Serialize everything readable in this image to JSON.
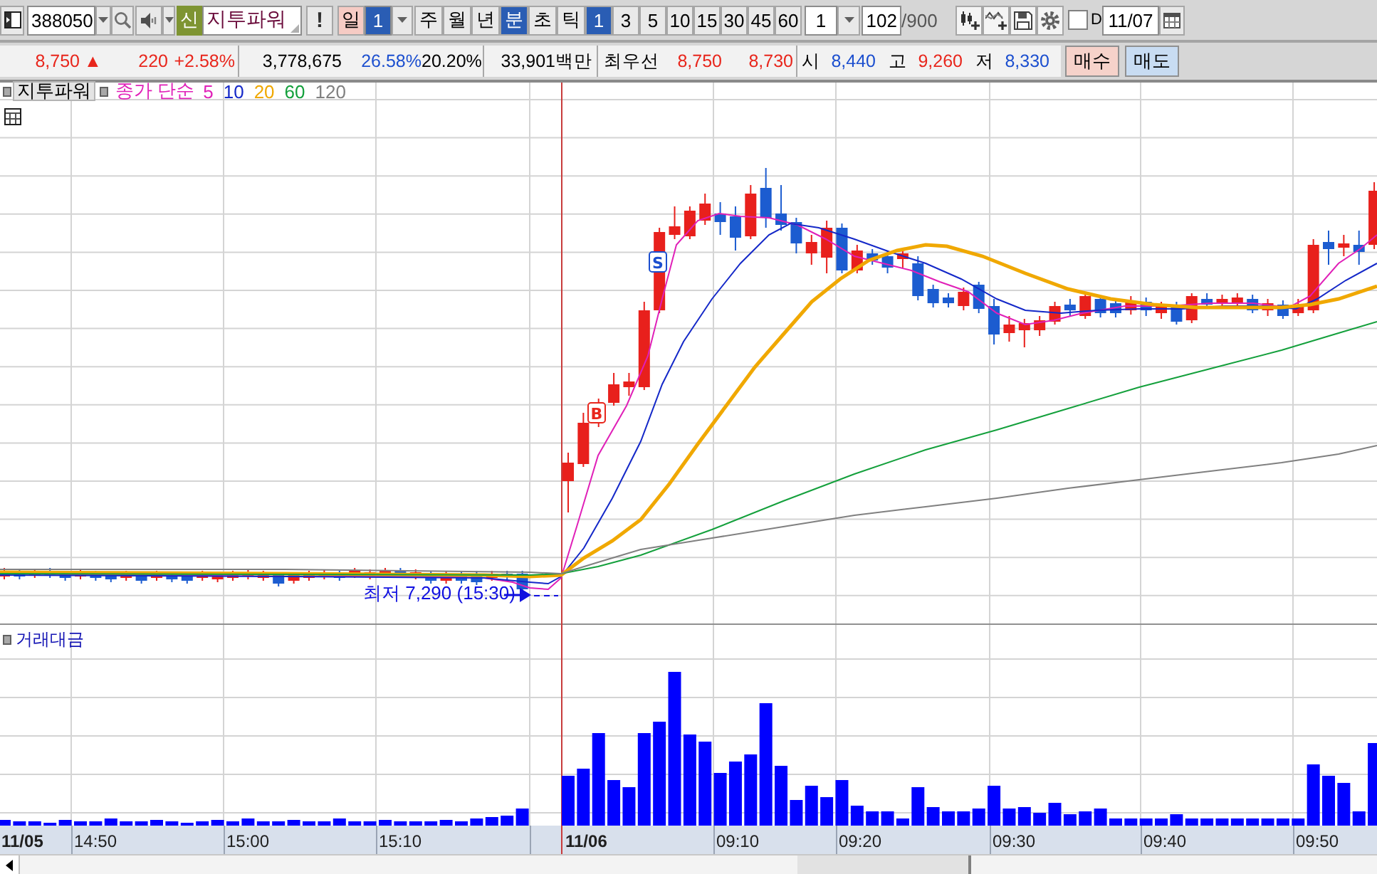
{
  "toolbar": {
    "stock_code": "388050",
    "market_badge": "신",
    "stock_name": "지투파워",
    "alert_button": "!",
    "day_button": "일",
    "day_count": {
      "value": "1",
      "selected": true
    },
    "period_tabs": [
      {
        "label": "주",
        "selected": false
      },
      {
        "label": "월",
        "selected": false
      },
      {
        "label": "년",
        "selected": false
      },
      {
        "label": "분",
        "selected": true
      },
      {
        "label": "초",
        "selected": false
      },
      {
        "label": "틱",
        "selected": false
      }
    ],
    "interval_buttons": [
      {
        "label": "1",
        "selected": true
      },
      {
        "label": "3",
        "selected": false
      },
      {
        "label": "5",
        "selected": false
      },
      {
        "label": "10",
        "selected": false
      },
      {
        "label": "15",
        "selected": false
      },
      {
        "label": "30",
        "selected": false
      },
      {
        "label": "45",
        "selected": false
      },
      {
        "label": "60",
        "selected": false
      }
    ],
    "interval_field": "1",
    "count_field": "102",
    "count_total": "/900",
    "date_toggle": {
      "label": "D",
      "checked": false
    },
    "date_field": "11/07"
  },
  "quote_bar": {
    "price_up": true,
    "price": "8,750",
    "price_arrow": "▲",
    "change": "220",
    "change_rate": "+2.58%",
    "volume": "3,778,675",
    "turnover_rate": "26.58%",
    "volume_ratio": "20.20%",
    "trade_amount": "33,901백만",
    "best_quote_label": "최우선",
    "best_ask": "8,750",
    "best_bid": "8,730",
    "ohlc": [
      {
        "label": "시",
        "value": "8,440",
        "color": "#1c4fcf"
      },
      {
        "label": "고",
        "value": "9,260",
        "color": "#e8261c"
      },
      {
        "label": "저",
        "value": "8,330",
        "color": "#1c4fcf"
      }
    ],
    "buy_button": "매수",
    "sell_button": "매도"
  },
  "price_pane": {
    "series_button": "지투파워",
    "ma_label": "종가 단순",
    "moving_averages": [
      {
        "period": "5",
        "color": "#e020b8"
      },
      {
        "period": "10",
        "color": "#1428c8"
      },
      {
        "period": "20",
        "color": "#f0a800"
      },
      {
        "period": "60",
        "color": "#14a03c"
      },
      {
        "period": "120",
        "color": "#808080"
      }
    ],
    "signals": [
      {
        "kind": "sell",
        "label": "S"
      },
      {
        "kind": "buy",
        "label": "B"
      }
    ],
    "low_annotation": "최저 7,290 (15:30)"
  },
  "volume_pane": {
    "title": "거래대금"
  },
  "time_axis": {
    "labels": [
      {
        "text": "11/05",
        "kind": "date"
      },
      {
        "text": "14:50",
        "kind": "time"
      },
      {
        "text": "15:00",
        "kind": "time"
      },
      {
        "text": "15:10",
        "kind": "time"
      },
      {
        "text": "11/06",
        "kind": "date"
      },
      {
        "text": "09:10",
        "kind": "time"
      },
      {
        "text": "09:20",
        "kind": "time"
      },
      {
        "text": "09:30",
        "kind": "time"
      },
      {
        "text": "09:40",
        "kind": "time"
      },
      {
        "text": "09:50",
        "kind": "time"
      }
    ]
  }
}
